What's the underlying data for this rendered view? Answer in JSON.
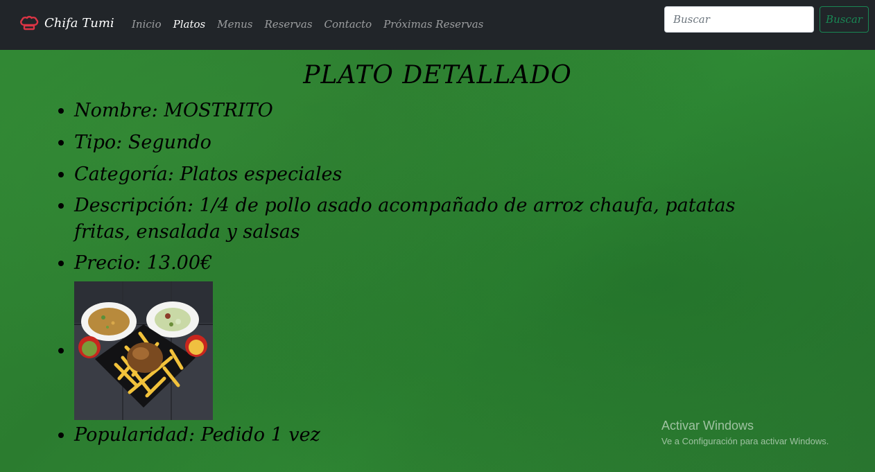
{
  "navbar": {
    "brand": "Chifa Tumi",
    "brand_icon": "chef-hat-icon",
    "links": [
      {
        "label": "Inicio",
        "active": false
      },
      {
        "label": "Platos",
        "active": true
      },
      {
        "label": "Menus",
        "active": false
      },
      {
        "label": "Reservas",
        "active": false
      },
      {
        "label": "Contacto",
        "active": false
      },
      {
        "label": "Próximas Reservas",
        "active": false
      }
    ],
    "search": {
      "placeholder": "Buscar",
      "value": "",
      "button_label": "Buscar"
    }
  },
  "main": {
    "title": "PLATO DETALLADO",
    "details": {
      "nombre": "Nombre: MOSTRITO",
      "tipo": "Tipo: Segundo",
      "categoria": "Categoría: Platos especiales",
      "descripcion": "Descripción: 1/4 de pollo asado acompañado de arroz chaufa, patatas fritas, ensalada y salsas",
      "precio": "Precio: 13.00€",
      "popularidad": "Popularidad: Pedido 1 vez"
    }
  },
  "watermark": {
    "title": "Activar Windows",
    "subtitle": "Ve a Configuración para activar Windows."
  },
  "colors": {
    "navbar_bg": "#212529",
    "brand_icon": "#dc3545",
    "search_button": "#198754",
    "background": "#2f8633"
  }
}
